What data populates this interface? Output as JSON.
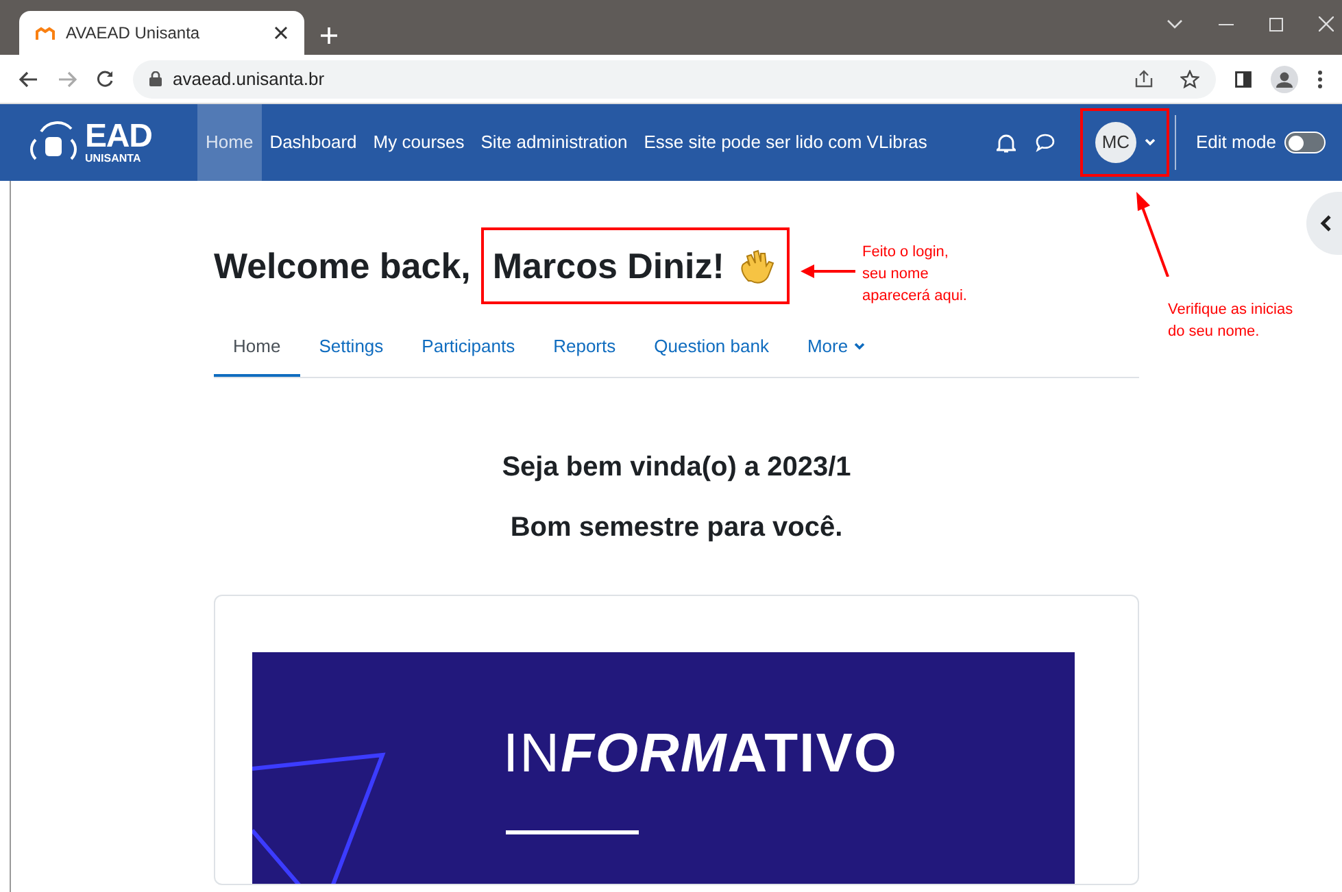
{
  "browser": {
    "tab_title": "AVAEAD Unisanta",
    "url": "avaead.unisanta.br"
  },
  "navbar": {
    "logo_text": "EAD",
    "logo_sub": "UNISANTA",
    "links": [
      {
        "label": "Home",
        "selected": true
      },
      {
        "label": "Dashboard",
        "selected": false
      },
      {
        "label": "My courses",
        "selected": false
      },
      {
        "label": "Site administration",
        "selected": false
      },
      {
        "label": "Esse site pode ser lido com VLibras",
        "selected": false
      }
    ],
    "avatar": "MC",
    "edit_mode": {
      "label": "Edit mode",
      "on": false
    }
  },
  "heading": {
    "prefix": "Welcome back,",
    "name": "Marcos Diniz!"
  },
  "course_tabs": [
    {
      "label": "Home",
      "selected": true,
      "kind": "link"
    },
    {
      "label": "Settings",
      "selected": false,
      "kind": "link"
    },
    {
      "label": "Participants",
      "selected": false,
      "kind": "link"
    },
    {
      "label": "Reports",
      "selected": false,
      "kind": "link"
    },
    {
      "label": "Question bank",
      "selected": false,
      "kind": "link"
    },
    {
      "label": "More",
      "selected": false,
      "kind": "dropdown"
    }
  ],
  "welcome_lines": [
    "Seja bem vinda(o) a 2023/1",
    "Bom semestre para você."
  ],
  "banner": {
    "title_parts": [
      {
        "text": "IN",
        "kind": "light"
      },
      {
        "text": "FORM",
        "kind": "slanted"
      },
      {
        "text": "ATIVO",
        "kind": "heavy"
      }
    ]
  },
  "annotations": [
    {
      "lines": [
        "Feito o login,",
        "seu nome",
        "aparecerá aqui."
      ]
    },
    {
      "lines": [
        "Verifique as inicias",
        "do seu nome."
      ]
    }
  ]
}
